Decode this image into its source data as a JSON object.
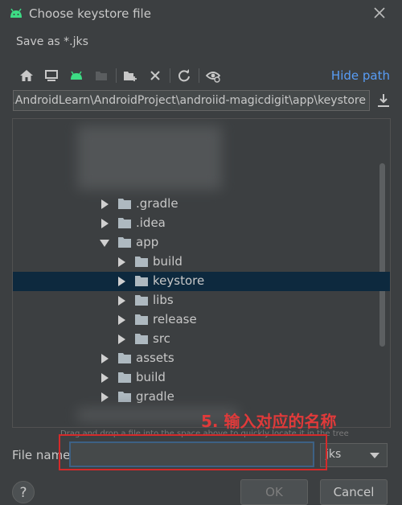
{
  "window": {
    "title": "Choose keystore file",
    "subtitle": "Save as *.jks"
  },
  "toolbar": {
    "hide_path_label": "Hide path"
  },
  "path": {
    "value": "...AndroidLearn\\AndroidProject\\androiid-magicdigit\\app\\keystore"
  },
  "tree": {
    "items": [
      {
        "name": ".gradle"
      },
      {
        "name": ".idea"
      },
      {
        "name": "app"
      },
      {
        "name": "build"
      },
      {
        "name": "keystore"
      },
      {
        "name": "libs"
      },
      {
        "name": "release"
      },
      {
        "name": "src"
      },
      {
        "name": "assets"
      },
      {
        "name": "build"
      },
      {
        "name": "gradle"
      }
    ]
  },
  "hint": "Drag and drop a file into the space above to quickly locate it in the tree",
  "annotation": "5. 输入对应的名称",
  "file_name": {
    "label": "File name:",
    "value": ""
  },
  "extension": {
    "selected": "jks"
  },
  "buttons": {
    "ok": "OK",
    "cancel": "Cancel",
    "help": "?"
  },
  "colors": {
    "background": "#3c3f41",
    "selection": "#0d293e",
    "link": "#589df6",
    "android_green": "#3ddc84",
    "annotation_red": "#e03a3a"
  }
}
